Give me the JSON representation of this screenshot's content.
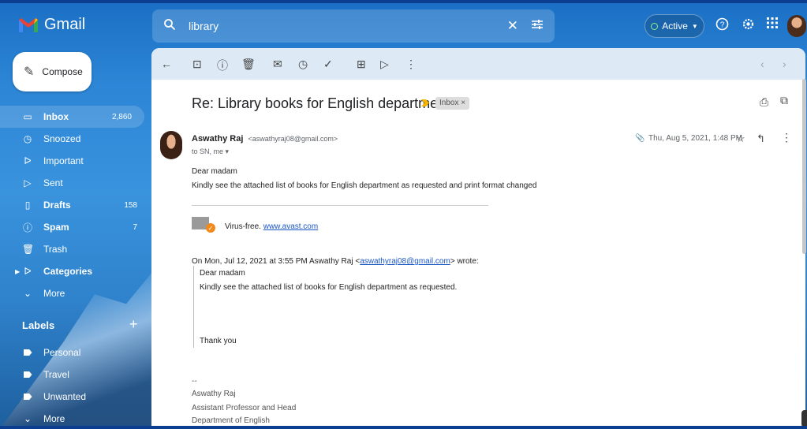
{
  "brand": {
    "name": "Gmail",
    "logo_icon": "gmail-logo-icon"
  },
  "search": {
    "value": "library"
  },
  "status": {
    "label": "Active",
    "color": "#8ef08e"
  },
  "compose": {
    "label": "Compose"
  },
  "nav": [
    {
      "label": "Inbox",
      "count": "2,860",
      "icon": "inbox-icon",
      "bold": true
    },
    {
      "label": "Snoozed",
      "count": "",
      "icon": "clock-icon",
      "bold": false
    },
    {
      "label": "Important",
      "count": "",
      "icon": "important-icon",
      "bold": false
    },
    {
      "label": "Sent",
      "count": "",
      "icon": "send-icon",
      "bold": false
    },
    {
      "label": "Drafts",
      "count": "158",
      "icon": "draft-icon",
      "bold": true
    },
    {
      "label": "Spam",
      "count": "7",
      "icon": "spam-icon",
      "bold": true
    },
    {
      "label": "Trash",
      "count": "",
      "icon": "trash-icon",
      "bold": false
    },
    {
      "label": "Categories",
      "count": "",
      "icon": "label-icon",
      "bold": true
    },
    {
      "label": "More",
      "count": "",
      "icon": "chevron-down-icon",
      "bold": false
    }
  ],
  "labels": {
    "heading": "Labels",
    "items": [
      {
        "label": "Personal"
      },
      {
        "label": "Travel"
      },
      {
        "label": "Unwanted"
      },
      {
        "label": "More"
      }
    ]
  },
  "email": {
    "subject": "Re: Library books for English department",
    "chip": "Inbox ×",
    "sender_name": "Aswathy Raj",
    "sender_email": "<aswathyraj08@gmail.com>",
    "to": "to SN, me ▾",
    "date": "Thu, Aug 5, 2021, 1:48 PM",
    "greeting": "Dear madam",
    "body": "Kindly see the attached list of books for English department as requested and print format changed",
    "avast_text": "Virus-free.",
    "avast_link": "www.avast.com",
    "quote_header_pre": "On Mon, Jul 12, 2021 at 3:55 PM Aswathy Raj <",
    "quote_header_link": "aswathyraj08@gmail.com",
    "quote_header_post": "> wrote:",
    "quote_greeting": "Dear madam",
    "quote_body": "Kindly see the attached list of books for English department as requested.",
    "quote_thanks": "Thank you",
    "sig_dashes": "--",
    "sig_name": "Aswathy Raj",
    "sig_title": "Assistant Professor and Head",
    "sig_dept": "Department of English"
  },
  "colors": {
    "accent": "#1a6fc4",
    "link": "#1a56c4",
    "important": "#f4b400",
    "avast": "#f08a1a"
  }
}
